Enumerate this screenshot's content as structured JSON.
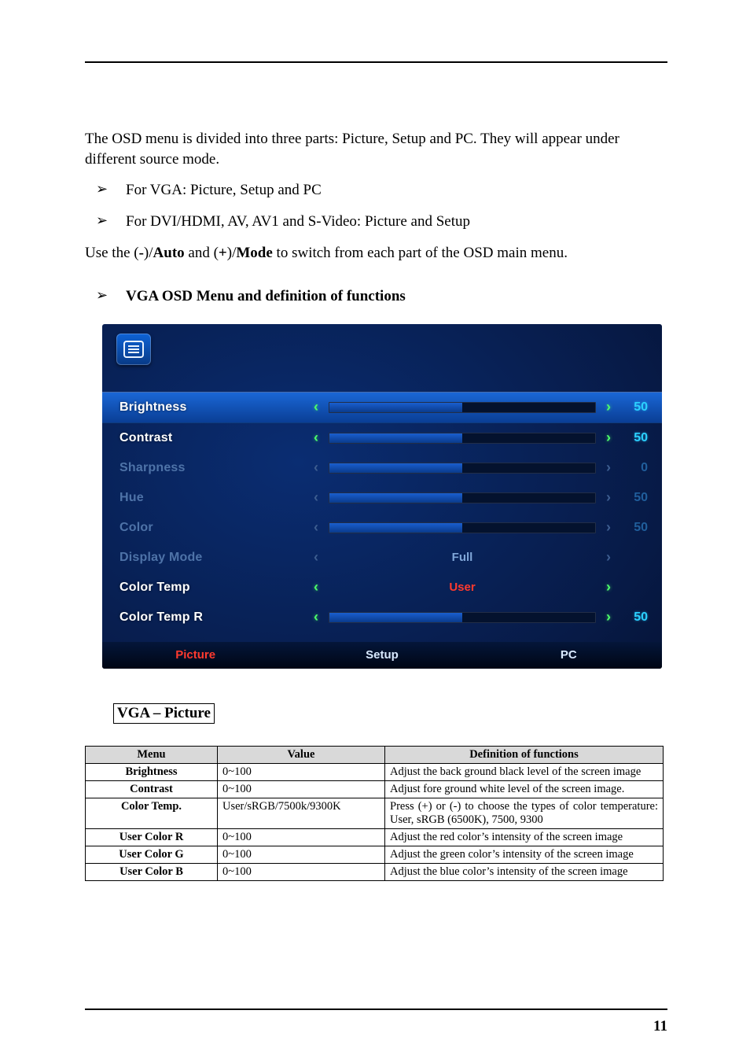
{
  "intro": "The OSD menu is divided into three parts:  Picture, Setup and PC. They will appear under different source mode.",
  "bullets": [
    "For VGA: Picture, Setup and PC",
    "For DVI/HDMI, AV, AV1 and S-Video: Picture and Setup"
  ],
  "switch_sentence": {
    "p1": "Use the (",
    "b1": "-",
    "p2": ")/",
    "b2": "Auto",
    "p3": " and (",
    "b3": "+",
    "p4": ")/",
    "b4": "Mode",
    "p5": " to switch from each part of the OSD main menu."
  },
  "section_heading": "VGA OSD Menu and definition of functions",
  "osd": {
    "rows": [
      {
        "label": "Brightness",
        "kind": "slider",
        "enabled": true,
        "highlight": true,
        "fill": 50,
        "value": "50"
      },
      {
        "label": "Contrast",
        "kind": "slider",
        "enabled": true,
        "highlight": false,
        "fill": 50,
        "value": "50"
      },
      {
        "label": "Sharpness",
        "kind": "slider",
        "enabled": false,
        "highlight": false,
        "fill": 50,
        "value": "0"
      },
      {
        "label": "Hue",
        "kind": "slider",
        "enabled": false,
        "highlight": false,
        "fill": 50,
        "value": "50"
      },
      {
        "label": "Color",
        "kind": "slider",
        "enabled": false,
        "highlight": false,
        "fill": 50,
        "value": "50"
      },
      {
        "label": "Display Mode",
        "kind": "choice",
        "enabled": false,
        "highlight": false,
        "choice": "Full"
      },
      {
        "label": "Color Temp",
        "kind": "choice",
        "enabled": true,
        "highlight": false,
        "choice": "User"
      },
      {
        "label": "Color Temp  R",
        "kind": "slider",
        "enabled": true,
        "highlight": false,
        "fill": 50,
        "value": "50"
      }
    ],
    "tabs": [
      "Picture",
      "Setup",
      "PC"
    ],
    "active_tab": 0
  },
  "boxed_label": "VGA – Picture",
  "table": {
    "headers": [
      "Menu",
      "Value",
      "Definition of functions"
    ],
    "rows": [
      [
        "Brightness",
        "0~100",
        "Adjust the back ground black level of the screen image"
      ],
      [
        "Contrast",
        "0~100",
        "Adjust fore ground white level of the screen image."
      ],
      [
        "Color Temp.",
        "User/sRGB/7500k/9300K",
        "Press (+) or (-) to choose the types of color temperature: User, sRGB (6500K), 7500, 9300"
      ],
      [
        "User Color R",
        "0~100",
        "Adjust the red color’s intensity of the screen image"
      ],
      [
        "User Color G",
        "0~100",
        "Adjust the green color’s intensity of the screen image"
      ],
      [
        "User Color B",
        "0~100",
        "Adjust the blue color’s intensity of the screen image"
      ]
    ]
  },
  "page_number": "11",
  "glyphs": {
    "bullet": "➢",
    "left": "‹",
    "right": "›"
  }
}
